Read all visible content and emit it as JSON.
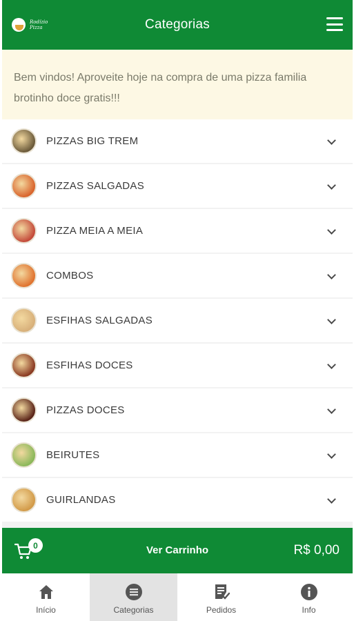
{
  "header": {
    "logo_text_line1": "Rodízio",
    "logo_text_line2": "Pizza",
    "title": "Categorias",
    "menu_icon": "hamburger-menu-icon"
  },
  "banner": {
    "text": "Bem vindos! Aproveite hoje na compra de uma pizza familia brotinho doce gratis!!!"
  },
  "categories": [
    {
      "label": "PIZZAS BIG TREM",
      "thumb_color": "#6b5a3a"
    },
    {
      "label": "PIZZAS SALGADAS",
      "thumb_color": "#d9642c"
    },
    {
      "label": "PIZZA MEIA A MEIA",
      "thumb_color": "#c44a3a"
    },
    {
      "label": "COMBOS",
      "thumb_color": "#e0732f"
    },
    {
      "label": "ESFIHAS SALGADAS",
      "thumb_color": "#d8b07a"
    },
    {
      "label": "ESFIHAS DOCES",
      "thumb_color": "#8a3a22"
    },
    {
      "label": "PIZZAS DOCES",
      "thumb_color": "#5a2418"
    },
    {
      "label": "BEIRUTES",
      "thumb_color": "#8bb85a"
    },
    {
      "label": "GUIRLANDAS",
      "thumb_color": "#d29a48"
    }
  ],
  "cart": {
    "count": "0",
    "label": "Ver Carrinho",
    "total": "R$ 0,00",
    "icon": "cart-icon"
  },
  "nav": [
    {
      "label": "Início",
      "icon": "home-icon",
      "active": false
    },
    {
      "label": "Categorias",
      "icon": "list-icon",
      "active": true
    },
    {
      "label": "Pedidos",
      "icon": "orders-icon",
      "active": false
    },
    {
      "label": "Info",
      "icon": "info-icon",
      "active": false
    }
  ],
  "colors": {
    "brand_green": "#0f8a35",
    "banner_bg": "#fdf8e4",
    "nav_active_bg": "#e3e3e3"
  }
}
